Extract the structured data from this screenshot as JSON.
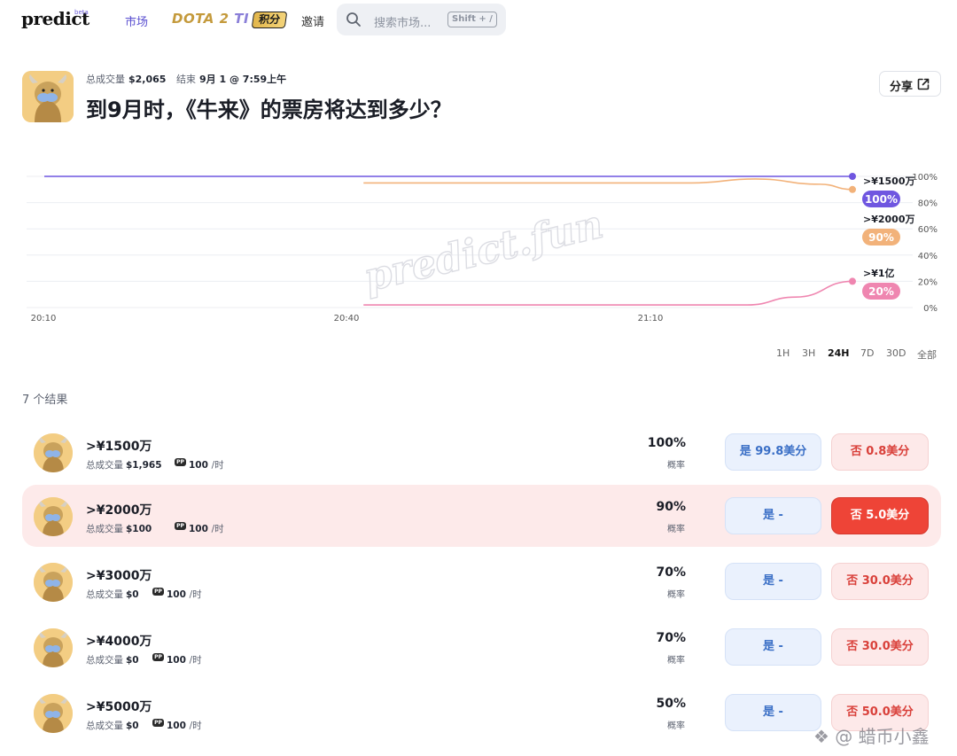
{
  "nav": {
    "logo": "predict",
    "logo_badge": "beta",
    "markets": "市场",
    "dota_main": "DOTA 2",
    "dota_ti": "TI",
    "points": "积分",
    "invite": "邀请",
    "search_placeholder": "搜索市场...",
    "search_shortcut": "Shift + /"
  },
  "market": {
    "volume_label": "总成交量",
    "volume_value": "$2,065",
    "end_label": "结束",
    "end_value": "9月 1 @ 7:59上午",
    "title": "到9月时，《牛来》的票房将达到多少？",
    "share_label": "分享"
  },
  "chart_data": {
    "type": "line",
    "x_ticks": [
      "20:10",
      "20:40",
      "21:10"
    ],
    "y_ticks": [
      "100%",
      "80%",
      "60%",
      "40%",
      "20%",
      "0%"
    ],
    "ylim": [
      0,
      100
    ],
    "grid": true,
    "watermark": "predict.fun",
    "series": [
      {
        "name": ">¥1500万",
        "value_label": "100%",
        "color": "#6f56e0",
        "points": [
          [
            0,
            100
          ],
          [
            0.5,
            100
          ],
          [
            1,
            100
          ]
        ]
      },
      {
        "name": ">¥2000万",
        "value_label": "90%",
        "color": "#f2b27a",
        "points": [
          [
            0.395,
            95
          ],
          [
            0.8,
            95
          ],
          [
            0.88,
            98
          ],
          [
            0.96,
            94
          ],
          [
            1,
            90
          ]
        ]
      },
      {
        "name": ">¥1亿",
        "value_label": "20%",
        "color": "#ef86b0",
        "points": [
          [
            0.395,
            2
          ],
          [
            0.87,
            2
          ],
          [
            0.93,
            8
          ],
          [
            1,
            20
          ]
        ]
      }
    ]
  },
  "ranges": [
    "1H",
    "3H",
    "24H",
    "7D",
    "30D",
    "全部"
  ],
  "active_range": "24H",
  "outcomes_count": "7 个结果",
  "outcomes": [
    {
      "label": ">¥1500万",
      "volume_label": "总成交量",
      "volume": "$1,965",
      "pp_icon": "PP",
      "rate": "100",
      "rate_unit": "/时",
      "prob": "100%",
      "prob_caption": "概率",
      "yes": "是 99.8美分",
      "no": "否 0.8美分",
      "highlight": false
    },
    {
      "label": ">¥2000万",
      "volume_label": "总成交量",
      "volume": "$100",
      "pp_icon": "PP",
      "rate": "100",
      "rate_unit": "/时",
      "prob": "90%",
      "prob_caption": "概率",
      "yes": "是 -",
      "no": "否 5.0美分",
      "highlight": true
    },
    {
      "label": ">¥3000万",
      "volume_label": "总成交量",
      "volume": "$0",
      "pp_icon": "PP",
      "rate": "100",
      "rate_unit": "/时",
      "prob": "70%",
      "prob_caption": "概率",
      "yes": "是 -",
      "no": "否 30.0美分",
      "highlight": false
    },
    {
      "label": ">¥4000万",
      "volume_label": "总成交量",
      "volume": "$0",
      "pp_icon": "PP",
      "rate": "100",
      "rate_unit": "/时",
      "prob": "70%",
      "prob_caption": "概率",
      "yes": "是 -",
      "no": "否 30.0美分",
      "highlight": false
    },
    {
      "label": ">¥5000万",
      "volume_label": "总成交量",
      "volume": "$0",
      "pp_icon": "PP",
      "rate": "100",
      "rate_unit": "/时",
      "prob": "50%",
      "prob_caption": "概率",
      "yes": "是 -",
      "no": "否 50.0美分",
      "highlight": false
    }
  ],
  "watermark_corner": "@ 蜡币小鑫"
}
